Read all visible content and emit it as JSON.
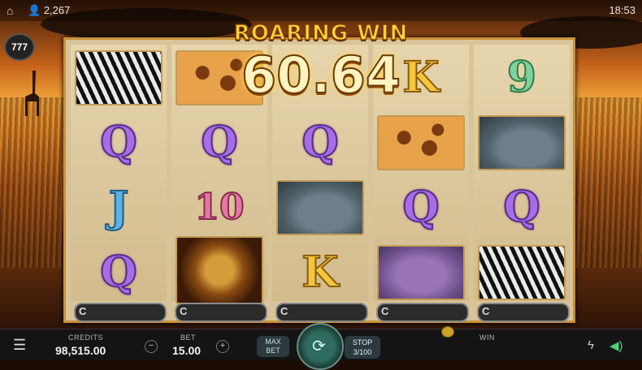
{
  "topbar": {
    "players": "2,267",
    "clock": "18:53"
  },
  "badge": "777",
  "banner": {
    "title": "ROARING WIN",
    "amount": "60.64"
  },
  "reels": [
    {
      "symbols": [
        "zebra",
        "Q",
        "J",
        "Q"
      ]
    },
    {
      "symbols": [
        "giraffe",
        "Q",
        "10",
        "lion"
      ]
    },
    {
      "symbols": [
        "Q",
        "rhino",
        "K"
      ]
    },
    {
      "symbols": [
        "K",
        "giraffe",
        "Q",
        "elephant"
      ]
    },
    {
      "symbols": [
        "9",
        "rhino",
        "Q",
        "zebra"
      ]
    }
  ],
  "reel_foot_label": "C",
  "bottom": {
    "credits_label": "CREDITS",
    "credits_value": "98,515.00",
    "bet_label": "BET",
    "bet_value": "15.00",
    "minus": "−",
    "plus": "+",
    "maxbet_line1": "MAX",
    "maxbet_line2": "BET",
    "stop_line1": "STOP",
    "stop_line2": "3/100",
    "win_label": "WIN",
    "win_value": ""
  },
  "icons": {
    "menu": "menu-icon",
    "spin": "spin-icon",
    "bolt": "lightning-icon",
    "sound": "sound-icon",
    "home": "home-icon",
    "players": "user-icon"
  }
}
